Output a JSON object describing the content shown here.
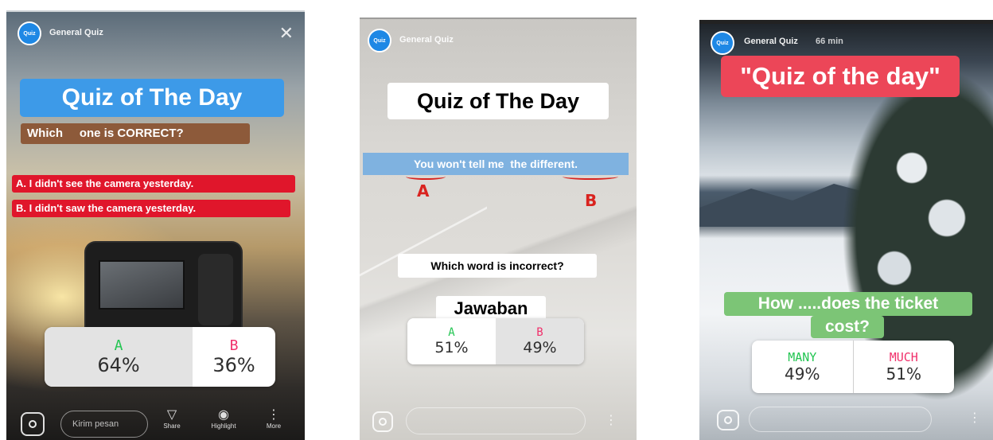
{
  "stories": [
    {
      "header": {
        "avatar_text": "Quiz",
        "account": "General Quiz",
        "time": ""
      },
      "title": "Quiz of The Day",
      "subtitle": "Which     one is CORRECT?",
      "option_a": "A. I didn't see the camera yesterday.",
      "option_b": "B. I didn't saw the camera yesterday.",
      "poll": [
        {
          "label": "A",
          "percent": "64%",
          "value": 64
        },
        {
          "label": "B",
          "percent": "36%",
          "value": 36
        }
      ],
      "footer": {
        "message_placeholder": "Kirim pesan",
        "actions": [
          "Share",
          "Highlight",
          "More"
        ]
      }
    },
    {
      "header": {
        "avatar_text": "Quiz",
        "account": "General Quiz",
        "time": ""
      },
      "title": "Quiz of The Day",
      "sentence": "You won't tell me  the different.",
      "marks": [
        "A",
        "B"
      ],
      "question": "Which word is incorrect?",
      "answer_label": "Jawaban",
      "poll": [
        {
          "label": "A",
          "percent": "51%",
          "value": 51
        },
        {
          "label": "B",
          "percent": "49%",
          "value": 49
        }
      ],
      "footer": {
        "message_placeholder": ""
      }
    },
    {
      "header": {
        "avatar_text": "Quiz",
        "account": "General Quiz",
        "time": "66 min"
      },
      "title": "\"Quiz of the day\"",
      "question_line1": "How .....does the ticket",
      "question_line2": "cost?",
      "poll": [
        {
          "label": "MANY",
          "percent": "49%",
          "value": 49
        },
        {
          "label": "MUCH",
          "percent": "51%",
          "value": 51
        }
      ],
      "footer": {
        "message_placeholder": ""
      }
    }
  ],
  "colors": {
    "brand_blue": "#1e88e5",
    "sticker_blue": "#3d9ae8",
    "sticker_brown": "#8d5a3a",
    "sticker_red": "#e0162b",
    "sticker_green": "#7cc576",
    "sticker_pink": "#ec4658",
    "poll_green": "#23c552",
    "poll_pink": "#f0306b",
    "annotation_red": "#d9231f"
  },
  "icons": [
    "camera-icon",
    "send-icon",
    "highlight-icon",
    "more-icon",
    "close-icon"
  ]
}
